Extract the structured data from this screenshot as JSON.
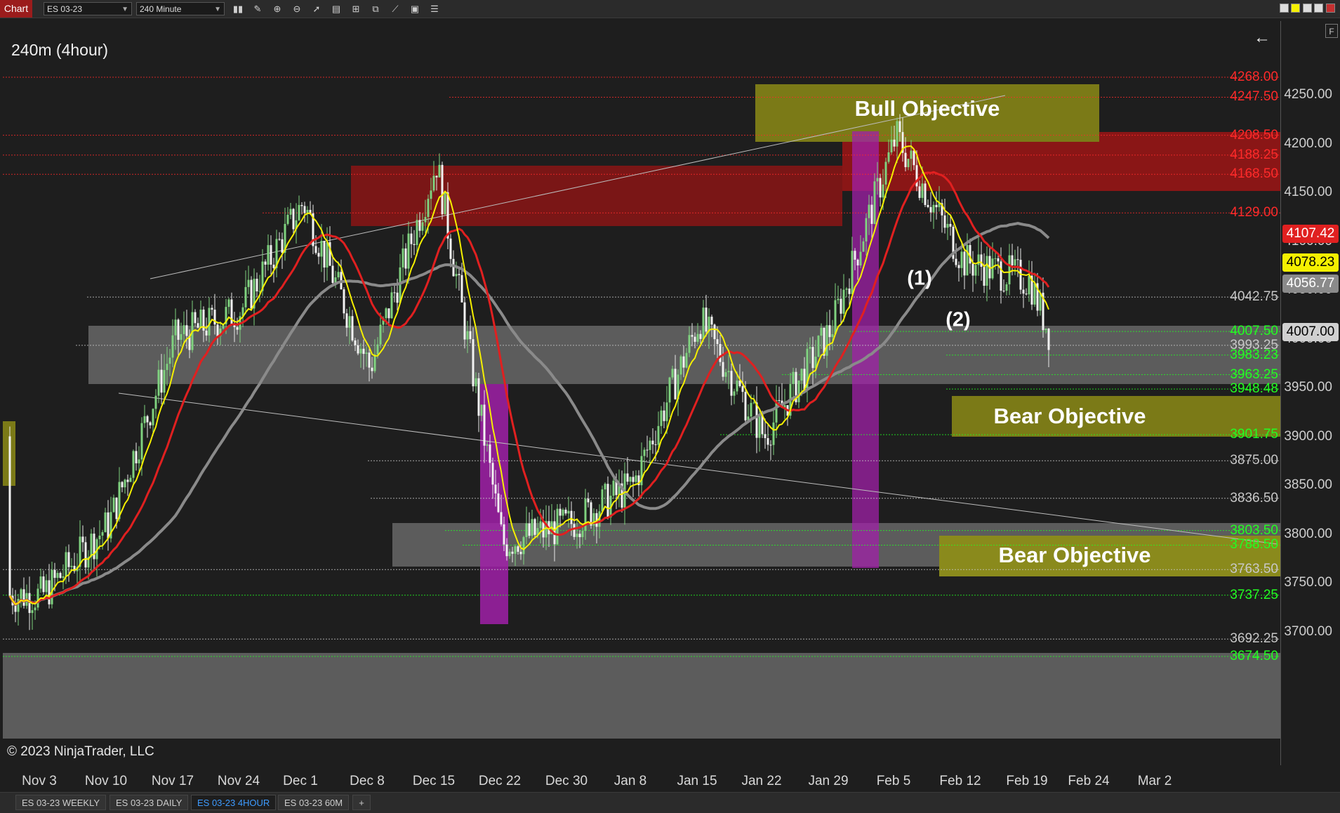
{
  "toolbar": {
    "app_label": "Chart",
    "instrument": "ES 03-23",
    "interval": "240 Minute"
  },
  "chart": {
    "title": "240m (4hour)",
    "copyright": "© 2023 NinjaTrader, LLC"
  },
  "price_axis": [
    "4250.00",
    "4200.00",
    "4150.00",
    "4100.00",
    "4050.00",
    "4000.00",
    "3950.00",
    "3900.00",
    "3850.00",
    "3800.00",
    "3750.00",
    "3700.00"
  ],
  "price_tags": [
    {
      "value": "4107.42",
      "bg": "#e02020",
      "fg": "#ffffff"
    },
    {
      "value": "4078.23",
      "bg": "#f5f000",
      "fg": "#000000"
    },
    {
      "value": "4056.77",
      "bg": "#8a8a8a",
      "fg": "#ffffff"
    },
    {
      "value": "4007.00",
      "bg": "#d0d0d0",
      "fg": "#000000"
    }
  ],
  "levels": [
    {
      "value": "4268.00",
      "color": "#ff2a2a"
    },
    {
      "value": "4247.50",
      "color": "#ff2a2a"
    },
    {
      "value": "4208.50",
      "color": "#ff2a2a"
    },
    {
      "value": "4188.25",
      "color": "#ff2a2a"
    },
    {
      "value": "4168.50",
      "color": "#ff2a2a"
    },
    {
      "value": "4129.00",
      "color": "#ff2a2a"
    },
    {
      "value": "4042.75",
      "color": "#c8c8c8"
    },
    {
      "value": "4007.50",
      "color": "#22ff22"
    },
    {
      "value": "3993.25",
      "color": "#c8c8c8"
    },
    {
      "value": "3983.23",
      "color": "#22ff22"
    },
    {
      "value": "3963.25",
      "color": "#22ff22"
    },
    {
      "value": "3948.48",
      "color": "#22ff22"
    },
    {
      "value": "3901.75",
      "color": "#22ff22"
    },
    {
      "value": "3875.00",
      "color": "#c8c8c8"
    },
    {
      "value": "3836.50",
      "color": "#c8c8c8"
    },
    {
      "value": "3803.50",
      "color": "#22ff22"
    },
    {
      "value": "3788.50",
      "color": "#22ff22"
    },
    {
      "value": "3763.50",
      "color": "#c8c8c8"
    },
    {
      "value": "3737.25",
      "color": "#22ff22"
    },
    {
      "value": "3692.25",
      "color": "#c8c8c8"
    },
    {
      "value": "3674.50",
      "color": "#22ff22"
    }
  ],
  "annotations": {
    "bull_objective": "Bull Objective",
    "bear_objective_1": "Bear Objective",
    "bear_objective_2": "Bear Objective",
    "wave_1": "(1)",
    "wave_2": "(2)"
  },
  "dates": [
    "Nov 3",
    "Nov 10",
    "Nov 17",
    "Nov 24",
    "Dec 1",
    "Dec 8",
    "Dec 15",
    "Dec 22",
    "Dec 30",
    "Jan 8",
    "Jan 15",
    "Jan 22",
    "Jan 29",
    "Feb 5",
    "Feb 12",
    "Feb 19",
    "Feb 24",
    "Mar 2"
  ],
  "tabs": [
    "ES 03-23 WEEKLY",
    "ES 03-23 DAILY",
    "ES 03-23 4HOUR",
    "ES 03-23 60M",
    "+"
  ],
  "active_tab": "ES 03-23 4HOUR",
  "chart_data": {
    "type": "candlestick",
    "title": "240m (4hour)",
    "ylim": [
      3665,
      4285
    ],
    "key_points": [
      {
        "x": "Nov 3",
        "y": 3737
      },
      {
        "x": "Nov 10",
        "y": 3810
      },
      {
        "x": "Nov 17",
        "y": 4000
      },
      {
        "x": "Nov 24",
        "y": 4030
      },
      {
        "x": "Dec 1",
        "y": 4140
      },
      {
        "x": "Dec 8",
        "y": 3970
      },
      {
        "x": "Dec 15",
        "y": 4180
      },
      {
        "x": "Dec 22",
        "y": 3790
      },
      {
        "x": "Dec 30",
        "y": 3810
      },
      {
        "x": "Jan 8",
        "y": 3850
      },
      {
        "x": "Jan 15",
        "y": 4020
      },
      {
        "x": "Jan 22",
        "y": 3900
      },
      {
        "x": "Jan 29",
        "y": 4010
      },
      {
        "x": "Feb 5",
        "y": 4208
      },
      {
        "x": "Feb 12",
        "y": 4080
      },
      {
        "x": "Feb 19",
        "y": 4060
      },
      {
        "x": "Feb 21",
        "y": 4007
      }
    ],
    "moving_averages": [
      {
        "color": "#f5f000",
        "last": 4078.23
      },
      {
        "color": "#e02020",
        "last": 4107.42
      },
      {
        "color": "#8a8a8a",
        "last": 4056.77
      }
    ],
    "last_price": 4007.0
  }
}
